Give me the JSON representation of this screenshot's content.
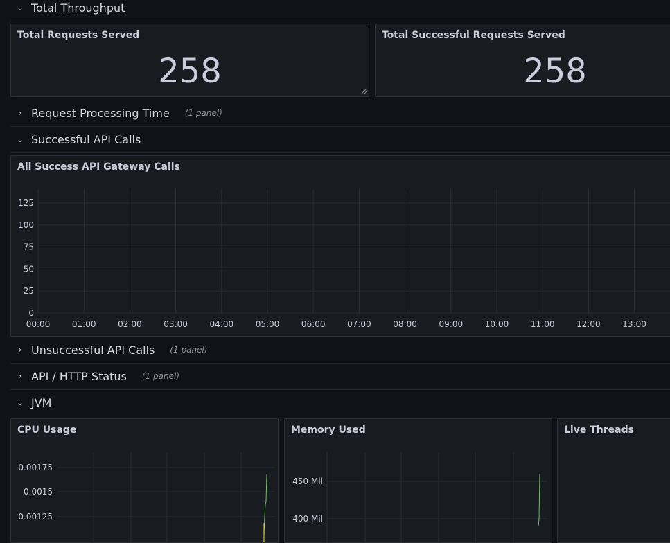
{
  "rows": {
    "total_throughput": {
      "title": "Total Throughput",
      "chevron": "⌄"
    },
    "request_processing": {
      "title": "Request Processing Time",
      "count": "(1 panel)",
      "chevron": "›"
    },
    "successful_api": {
      "title": "Successful API Calls",
      "chevron": "⌄"
    },
    "unsuccessful_api": {
      "title": "Unsuccessful API Calls",
      "count": "(1 panel)",
      "chevron": "›"
    },
    "http_status": {
      "title": "API / HTTP Status",
      "count": "(1 panel)",
      "chevron": "›"
    },
    "jvm": {
      "title": "JVM",
      "chevron": "⌄"
    }
  },
  "panels": {
    "total_requests": {
      "title": "Total Requests Served",
      "value": "258"
    },
    "total_success": {
      "title": "Total Successful Requests Served",
      "value": "258"
    },
    "success_calls": {
      "title": "All Success API Gateway Calls"
    },
    "cpu": {
      "title": "CPU Usage"
    },
    "memory": {
      "title": "Memory Used"
    },
    "threads": {
      "title": "Live Threads"
    }
  },
  "chart_data": [
    {
      "type": "line",
      "title": "All Success API Gateway Calls",
      "x_ticks": [
        "00:00",
        "01:00",
        "02:00",
        "03:00",
        "04:00",
        "05:00",
        "06:00",
        "07:00",
        "08:00",
        "09:00",
        "10:00",
        "11:00",
        "12:00",
        "13:00"
      ],
      "y_ticks": [
        "0",
        "25",
        "50",
        "75",
        "100",
        "125"
      ],
      "ylim": [
        0,
        125
      ],
      "series": []
    },
    {
      "type": "line",
      "title": "CPU Usage",
      "y_ticks": [
        "0.00175",
        "0.0015",
        "0.00125"
      ],
      "series": [
        {
          "values": [
            0.00125,
            0.00138,
            0.0014,
            0.00168
          ],
          "color": "#73bf69"
        }
      ]
    },
    {
      "type": "line",
      "title": "Memory Used",
      "y_ticks": [
        "450 Mil",
        "400 Mil"
      ],
      "series": [
        {
          "values": [
            390,
            400,
            460
          ],
          "color": "#73bf69"
        }
      ]
    }
  ]
}
